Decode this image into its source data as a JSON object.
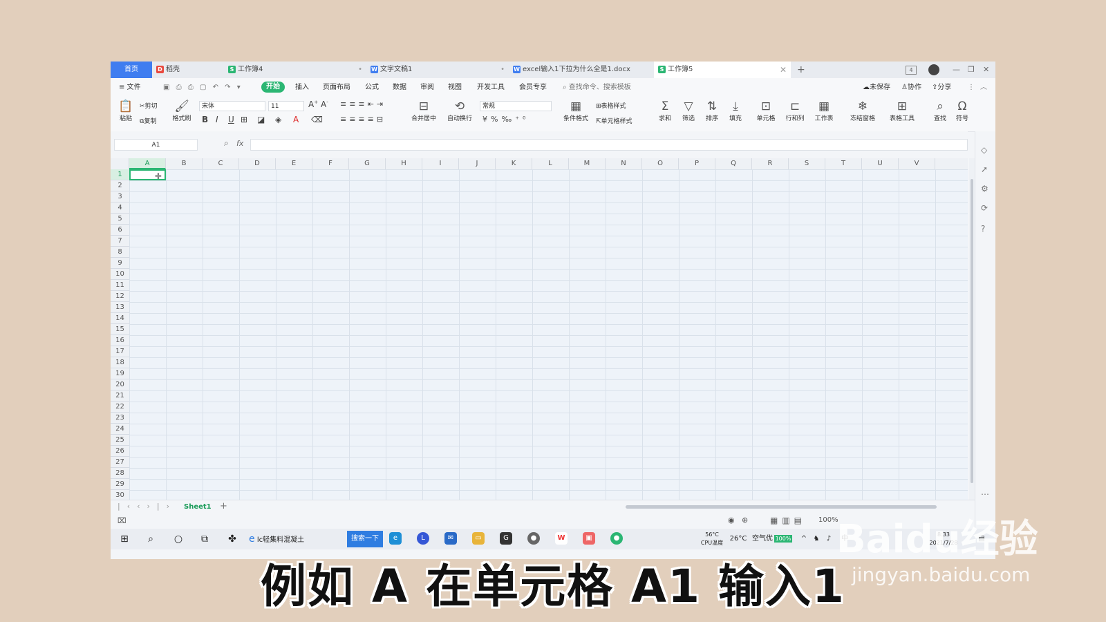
{
  "tabs": [
    {
      "label": "首页",
      "icon": ""
    },
    {
      "label": "稻壳",
      "icon": "D",
      "color": "#e94a3f"
    },
    {
      "label": "工作簿4",
      "icon": "S",
      "color": "#2bb673"
    },
    {
      "label": "文字文稿1",
      "icon": "W",
      "color": "#3f7df0"
    },
    {
      "label": "excel输入1下拉为什么全是1.docx",
      "icon": "W",
      "color": "#3f7df0"
    },
    {
      "label": "工作簿5",
      "icon": "S",
      "color": "#2bb673"
    }
  ],
  "tab_add": "+",
  "tab_count_badge": "4",
  "menu": {
    "file": "≡ 文件",
    "items": [
      "开始",
      "插入",
      "页面布局",
      "公式",
      "数据",
      "审阅",
      "视图",
      "开发工具",
      "会员专享"
    ],
    "search": "查找命令、搜索模板",
    "unsaved": "未保存",
    "collab": "协作",
    "share": "分享"
  },
  "ribbon": {
    "paste": "粘贴",
    "cut": "剪切",
    "copy": "复制",
    "format_painter": "格式刷",
    "font_name": "宋体",
    "font_size": "11",
    "merge_center": "合并居中",
    "wrap_text": "自动换行",
    "number_format": "常规",
    "cond_format": "条件格式",
    "table_style": "表格样式",
    "cell_style": "单元格样式",
    "sum": "求和",
    "filter": "筛选",
    "sort": "排序",
    "fill": "填充",
    "cell": "单元格",
    "row_col": "行和列",
    "worksheet": "工作表",
    "freeze": "冻结窗格",
    "table_tools": "表格工具",
    "find": "查找",
    "symbol": "符号"
  },
  "formula_bar": {
    "name_box": "A1",
    "fx": "fx",
    "value": ""
  },
  "columns": [
    "A",
    "B",
    "C",
    "D",
    "E",
    "F",
    "G",
    "H",
    "I",
    "J",
    "K",
    "L",
    "M",
    "N",
    "O",
    "P",
    "Q",
    "R",
    "S",
    "T",
    "U",
    "V"
  ],
  "rows": [
    "1",
    "2",
    "3",
    "4",
    "5",
    "6",
    "7",
    "8",
    "9",
    "10",
    "11",
    "12",
    "13",
    "14",
    "15",
    "16",
    "17",
    "18",
    "19",
    "20",
    "21",
    "22",
    "23",
    "24",
    "25",
    "26",
    "27",
    "28",
    "29",
    "30"
  ],
  "selected_cell": "A1",
  "sheet_tab": "Sheet1",
  "status": {
    "zoom": "100%"
  },
  "taskbar": {
    "search_text": "lc轻集料混凝土",
    "search_button": "搜索一下",
    "cpu_temp": "56°C",
    "cpu_label": "CPU温度",
    "weather": "26°C",
    "air": "空气优",
    "battery": "100%",
    "ime": "中",
    "time": "8:33",
    "date": "2021/7/28"
  },
  "caption": "例如 A 在单元格 A1 输入1",
  "watermark": {
    "brand": "Baidu经验",
    "url": "jingyan.baidu.com"
  },
  "colors": {
    "accent_green": "#2bb673",
    "home_blue": "#3f7df0",
    "background": "#e2cfbc"
  }
}
